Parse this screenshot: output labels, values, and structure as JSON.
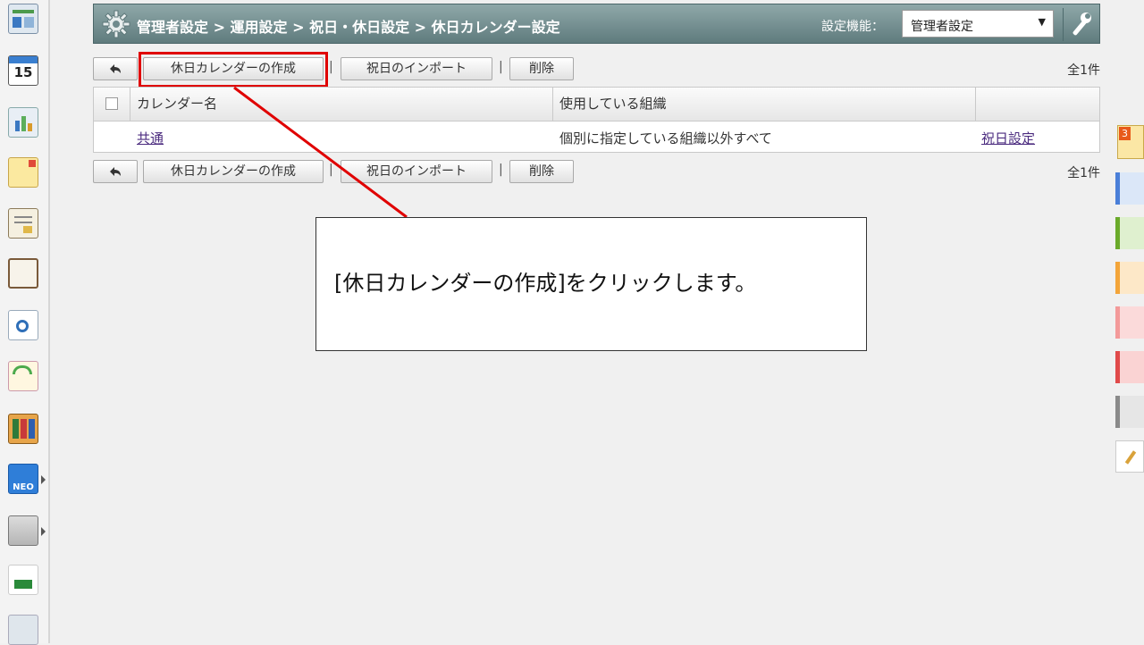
{
  "breadcrumb": "管理者設定 > 運用設定 > 祝日・休日設定 > 休日カレンダー設定",
  "header": {
    "setting_label": "設定機能：",
    "setting_value": "管理者設定",
    "select_arrow": "▼"
  },
  "toolbar": {
    "back_icon": "undo-arrow-icon",
    "create_label": "休日カレンダーの作成",
    "separator": "|",
    "import_label": "祝日のインポート",
    "delete_label": "削除",
    "count": "全1件"
  },
  "table": {
    "columns": [
      "カレンダー名",
      "使用している組織"
    ],
    "rows": [
      {
        "name": "共通",
        "orgs": "個別に指定している組織以外すべて",
        "action": "祝日設定"
      }
    ]
  },
  "callout": {
    "text": "[休日カレンダーの作成]をクリックします。",
    "border_color": "#e00000"
  },
  "sidebar_icons": [
    "dashboard-icon",
    "calendar-icon",
    "report-icon",
    "memo-icon",
    "bulletin-icon",
    "notepad-icon",
    "search-doc-icon",
    "workflow-icon",
    "cabinet-icon",
    "neo-icon",
    "folder-icon",
    "nanome-icon",
    "banner-icon"
  ],
  "calendar_icon_text": "15",
  "neo_icon_text": "NEO",
  "notification_badge": "3",
  "colors": {
    "header_dark": "#5f7b7d",
    "highlight_red": "#e00000",
    "link_purple": "#4b2b7f"
  }
}
